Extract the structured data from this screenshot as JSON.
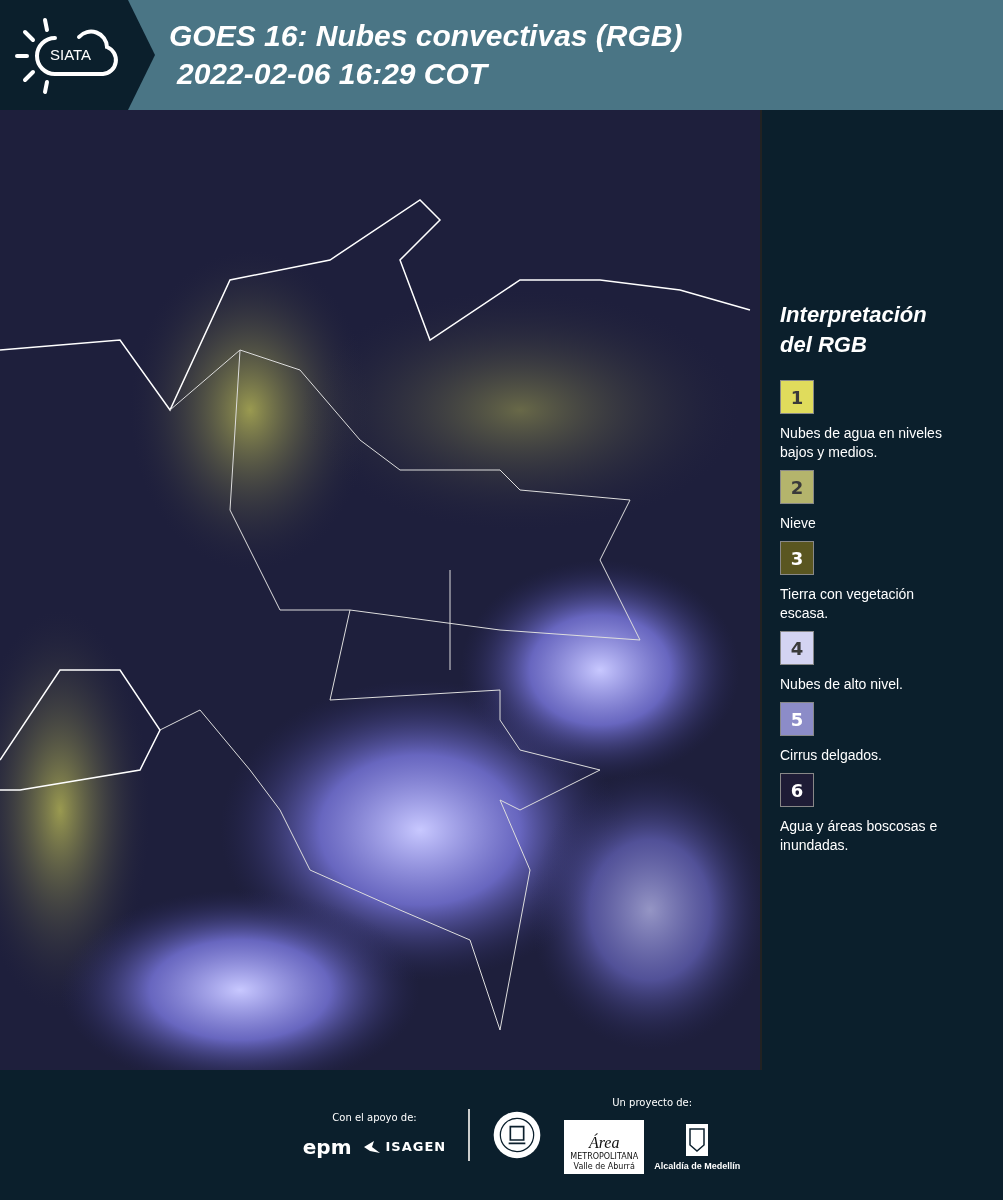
{
  "header": {
    "logo_text": "SIATA",
    "title": "GOES 16: Nubes convectivas (RGB)",
    "subtitle": "2022-02-06 16:29 COT"
  },
  "legend": {
    "title_line_1": "Interpretación",
    "title_line_2": "del RGB",
    "items": [
      {
        "number": "1",
        "color": "#e0dc5c",
        "label": "Nubes de agua en niveles bajos y medios."
      },
      {
        "number": "2",
        "color": "#b4b46c",
        "label": "Nieve"
      },
      {
        "number": "3",
        "color": "#5a5620",
        "label": "Tierra con vegetación escasa."
      },
      {
        "number": "4",
        "color": "#d4d4f2",
        "label": "Nubes de alto nivel."
      },
      {
        "number": "5",
        "color": "#8c8cc8",
        "label": "Cirrus delgados."
      },
      {
        "number": "6",
        "color": "#1e1c36",
        "label": "Agua y áreas boscosas e inundadas."
      }
    ]
  },
  "footer": {
    "support_label": "Con el apoyo de:",
    "support_logos": [
      "epm",
      "ISAGEN"
    ],
    "project_label": "Un proyecto de:",
    "area_logo": {
      "title": "Área",
      "line_1": "METROPOLITANA",
      "line_2": "Valle de Aburrá"
    },
    "alcaldia_label": "Alcaldía de Medellín"
  }
}
